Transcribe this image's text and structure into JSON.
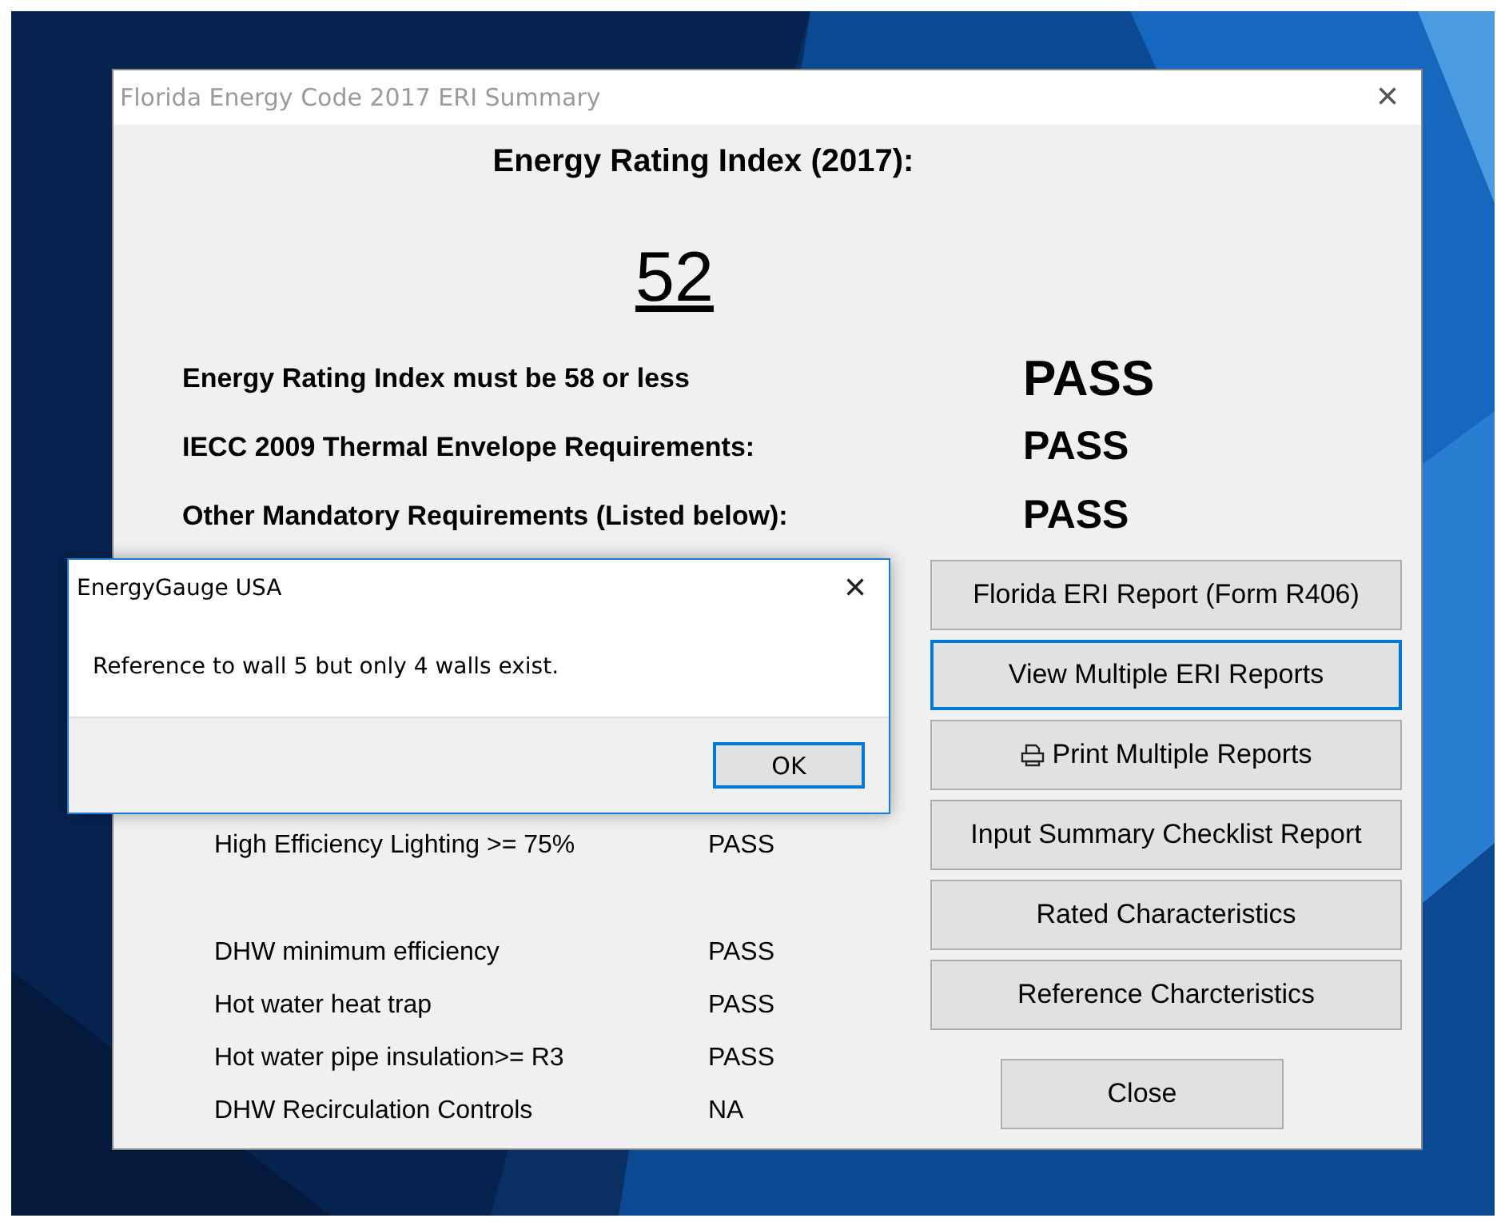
{
  "window": {
    "title": "Florida Energy Code 2017 ERI Summary",
    "close": "×"
  },
  "heading": "Energy Rating Index (2017):",
  "score": "52",
  "summary": [
    {
      "label": "Energy Rating Index must be 58 or less",
      "result": "PASS",
      "large": true
    },
    {
      "label": "IECC 2009 Thermal Envelope Requirements:",
      "result": "PASS",
      "large": false
    },
    {
      "label": "Other Mandatory Requirements (Listed below):",
      "result": "PASS",
      "large": false
    }
  ],
  "requirements": [
    {
      "label": "High Efficiency Lighting >= 75%",
      "result": "PASS"
    },
    {
      "kind": "gap"
    },
    {
      "label": "DHW minimum efficiency",
      "result": "PASS"
    },
    {
      "label": "Hot water heat trap",
      "result": "PASS"
    },
    {
      "label": "Hot water pipe insulation>= R3",
      "result": "PASS"
    },
    {
      "label": "DHW Recirculation Controls",
      "result": "NA"
    }
  ],
  "buttons": [
    {
      "label": "Florida ERI Report (Form R406)",
      "focused": false,
      "kind": "plain"
    },
    {
      "label": "View Multiple ERI Reports",
      "focused": true,
      "kind": "plain"
    },
    {
      "label": "Print Multiple Reports",
      "focused": false,
      "kind": "print"
    },
    {
      "label": "Input Summary Checklist Report",
      "focused": false,
      "kind": "plain"
    },
    {
      "label": "Rated Characteristics",
      "focused": false,
      "kind": "plain"
    },
    {
      "label": "Reference Charcteristics",
      "focused": false,
      "kind": "plain"
    }
  ],
  "close_button": "Close",
  "dialog": {
    "title": "EnergyGauge USA",
    "close": "×",
    "message": "Reference to wall 5 but only 4 walls exist.",
    "ok": "OK",
    "ok_focused": true
  }
}
